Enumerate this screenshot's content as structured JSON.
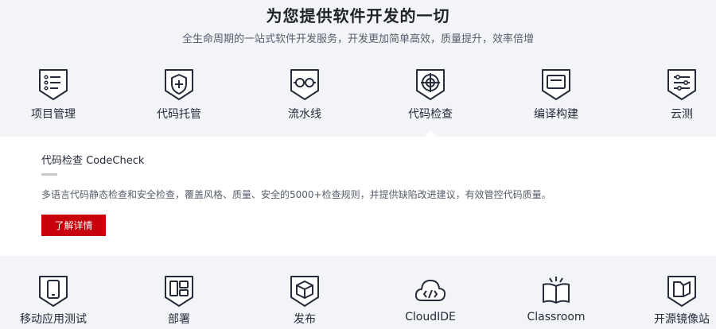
{
  "header": {
    "title": "为您提供软件开发的一切",
    "subtitle": "全生命周期的一站式软件开发服务，开发更加简单高效，质量提升，效率倍增"
  },
  "services_row1": [
    {
      "label": "项目管理",
      "icon": "list-icon"
    },
    {
      "label": "代码托管",
      "icon": "shield-plus-icon"
    },
    {
      "label": "流水线",
      "icon": "pipeline-icon"
    },
    {
      "label": "代码检查",
      "icon": "target-icon"
    },
    {
      "label": "编译构建",
      "icon": "terminal-icon"
    },
    {
      "label": "云测",
      "icon": "sliders-icon"
    }
  ],
  "selected_service": "代码检查",
  "detail": {
    "title": "代码检查 CodeCheck",
    "description": "多语言代码静态检查和安全检查，覆盖风格、质量、安全的5000+检查规则，并提供缺陷改进建议，有效管控代码质量。",
    "button_label": "了解详情",
    "button_color": "#c7000b"
  },
  "services_row2": [
    {
      "label": "移动应用测试",
      "icon": "mobile-icon"
    },
    {
      "label": "部署",
      "icon": "layout-icon"
    },
    {
      "label": "发布",
      "icon": "package-icon"
    },
    {
      "label": "CloudIDE",
      "icon": "cloud-code-icon"
    },
    {
      "label": "Classroom",
      "icon": "book-icon"
    },
    {
      "label": "开源镜像站",
      "icon": "mirror-icon"
    }
  ]
}
